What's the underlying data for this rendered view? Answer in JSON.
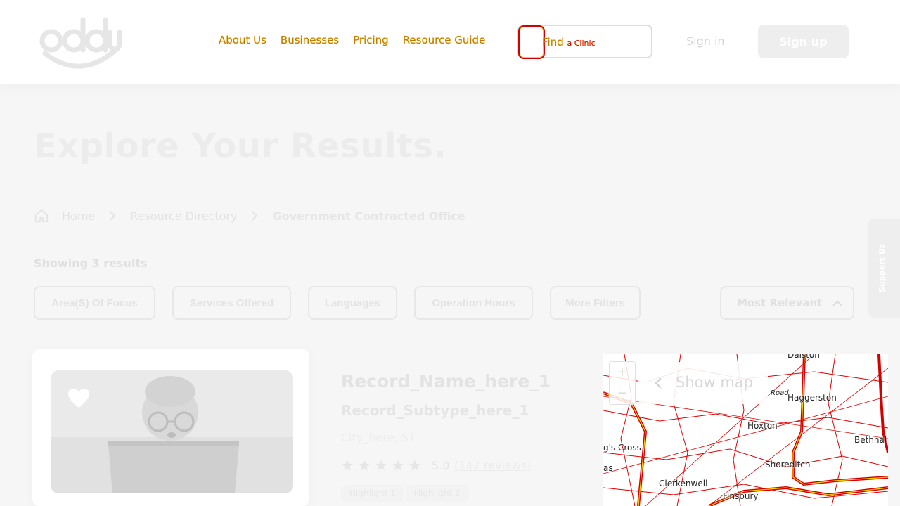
{
  "header": {
    "logo_text": "oddy",
    "nav": [
      {
        "label": "About Us"
      },
      {
        "label": "Businesses"
      },
      {
        "label": "Pricing"
      },
      {
        "label": "Resource Guide"
      }
    ],
    "find_button": "Find",
    "find_overlay": "a Clinic",
    "sign_in": "Sign in",
    "sign_up": "Sign up"
  },
  "page": {
    "title": "Explore Your Results.",
    "breadcrumb": [
      "Home",
      "Resource Directory",
      "Government Contracted Office"
    ],
    "showing_results": "Showing 3 results",
    "filters": [
      "Area(S) Of Focus",
      "Services Offered",
      "Languages",
      "Operation Hours",
      "More Filters"
    ],
    "sort_label": "Most Relevant",
    "support_tab": "Support Us"
  },
  "result": {
    "name": "Record_Name_here_1",
    "subtype": "Record_Subtype_here_1",
    "location": "City_here, ST",
    "stars": 5,
    "rating": "5.0",
    "reviews": "(147 reviews)",
    "highlights": [
      "Highlight 1",
      "Highlight 2"
    ]
  },
  "map": {
    "show_map": "Show map",
    "zoom_in": "+",
    "zoom_out": "−",
    "places": [
      "Dalston",
      "Haggerston",
      "Hoxton",
      "Bethnal",
      "Shoreditch",
      "Clerkenwell",
      "Finsbury",
      "g's Cross",
      "as",
      "Road"
    ]
  },
  "colors": {
    "highlight_red": "#d40000",
    "highlight_yellow": "#ffcc00",
    "faded_text": "#e3e3e3"
  }
}
